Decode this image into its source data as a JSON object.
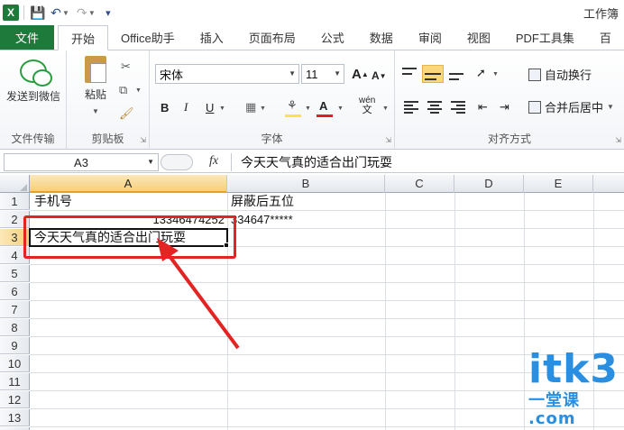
{
  "app": {
    "window_title": "工作簿"
  },
  "qat": {
    "icons": [
      "excel-logo-icon",
      "save-icon",
      "undo-icon",
      "redo-icon",
      "customize-icon"
    ]
  },
  "tabs": [
    {
      "label": "文件"
    },
    {
      "label": "开始"
    },
    {
      "label": "Office助手"
    },
    {
      "label": "插入"
    },
    {
      "label": "页面布局"
    },
    {
      "label": "公式"
    },
    {
      "label": "数据"
    },
    {
      "label": "审阅"
    },
    {
      "label": "视图"
    },
    {
      "label": "PDF工具集"
    },
    {
      "label": "百"
    }
  ],
  "ribbon": {
    "wechat": {
      "label": "发送到微信",
      "group": "文件传输"
    },
    "clipboard": {
      "paste_label": "粘贴",
      "group": "剪贴板"
    },
    "font": {
      "name": "宋体",
      "size": "11",
      "group": "字体",
      "grow": "A",
      "shrink": "A",
      "bold": "B",
      "italic": "I",
      "underline": "U",
      "font_color": "A",
      "pinyin": "wén"
    },
    "alignment": {
      "group": "对齐方式",
      "wrap_label": "自动换行",
      "merge_label": "合并后居中"
    },
    "colors": {
      "fill": "#f7e34a",
      "font": "#e02020"
    }
  },
  "formula_bar": {
    "name_box": "A3",
    "fx": "fx",
    "content": "今天天气真的适合出门玩耍"
  },
  "sheet": {
    "columns": [
      "A",
      "B",
      "C",
      "D",
      "E"
    ],
    "selected_column": "A",
    "rows": [
      "1",
      "2",
      "3",
      "4",
      "5",
      "6",
      "7",
      "8",
      "9",
      "10",
      "11",
      "12",
      "13",
      "14"
    ],
    "selected_row": "3",
    "cells": {
      "A1": "手机号",
      "B1": "屏蔽后五位",
      "A2": "13346474252",
      "B2": "334647*****",
      "A3": "今天天气真的适合出门玩耍"
    }
  },
  "watermark": {
    "text": "itk3",
    "sub": ".com",
    "cn": "一堂课"
  }
}
